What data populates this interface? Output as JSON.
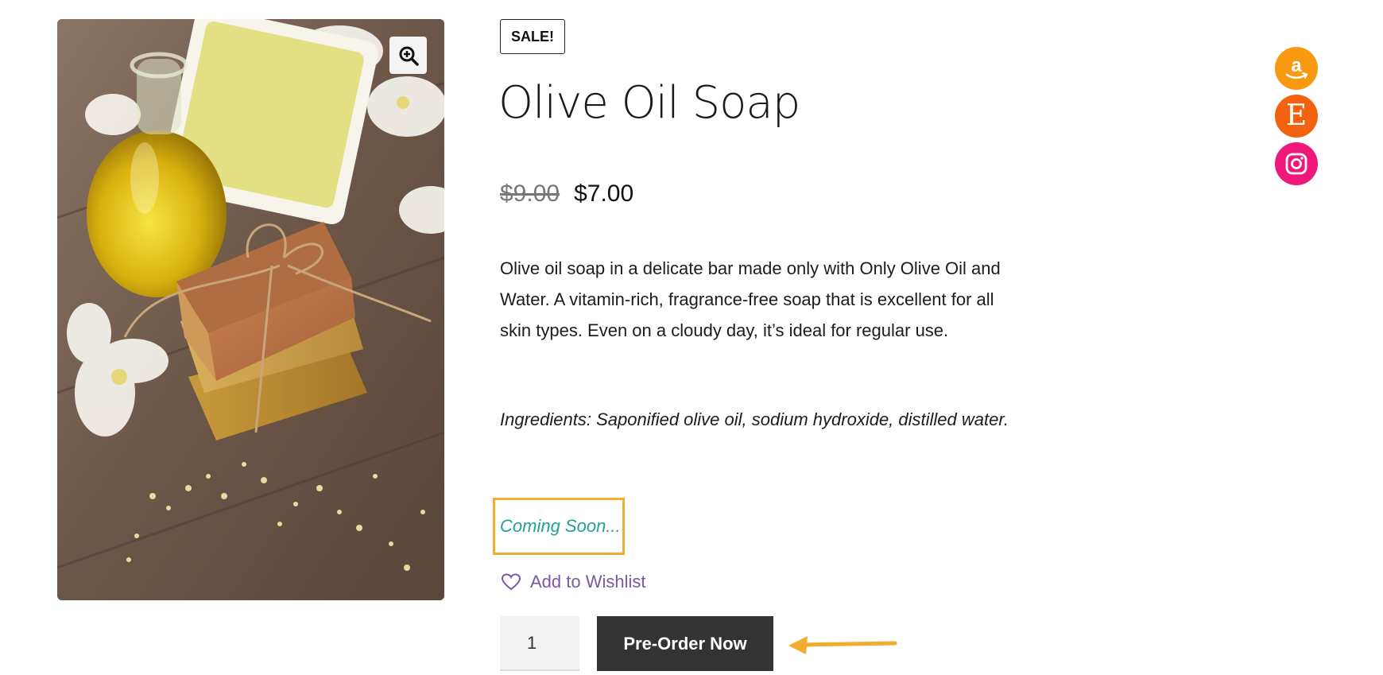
{
  "product": {
    "badge": "SALE!",
    "title": "Olive Oil Soap",
    "price_old": "$9.00",
    "price_new": "$7.00",
    "description": "Olive oil soap in a delicate bar made only with Only Olive Oil and Water. A vitamin-rich, fragrance-free soap that is excellent for all skin types. Even on a cloudy day, it’s ideal for regular use.",
    "ingredients": "Ingredients: Saponified olive oil, sodium hydroxide, distilled water.",
    "availability": "Coming Soon...",
    "wishlist_label": "Add to Wishlist",
    "quantity": "1",
    "preorder_label": "Pre-Order Now"
  },
  "image": {
    "zoom_icon": "zoom-in-icon",
    "subject": "olive-oil-soap-photo"
  },
  "social": [
    {
      "name": "amazon",
      "icon": "amazon-icon",
      "color": "#f79a12"
    },
    {
      "name": "etsy",
      "icon": "etsy-icon",
      "letter": "E",
      "color": "#f3620f"
    },
    {
      "name": "instagram",
      "icon": "instagram-icon",
      "color": "#ef1779"
    }
  ],
  "colors": {
    "availability": "#21a290",
    "wishlist": "#7b58a6",
    "highlight": "#f1ad2d",
    "button": "#333333"
  }
}
